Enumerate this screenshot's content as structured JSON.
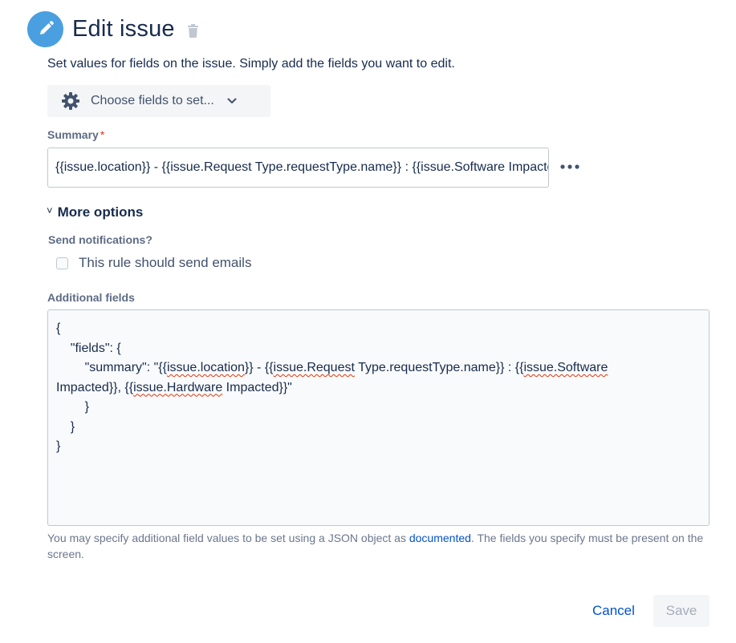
{
  "header": {
    "title": "Edit issue",
    "icon": "pencil-icon",
    "accent": "#4a9fe0"
  },
  "intro": "Set values for fields on the issue. Simply add the fields you want to edit.",
  "choose_fields": {
    "label": "Choose fields to set...",
    "icon": "gear-icon"
  },
  "summary": {
    "label": "Summary",
    "required_mark": "*",
    "value": "{{issue.location}} - {{issue.Request Type.requestType.name}} : {{issue.Software Impacted}}, {{issue.Hardware Impacted}}"
  },
  "more_options": {
    "caret": "˅",
    "label": "More options"
  },
  "notifications": {
    "label": "Send notifications?",
    "checkbox_label": "This rule should send emails",
    "checked": false
  },
  "additional_fields": {
    "label": "Additional fields",
    "lines": {
      "l1": "{",
      "l2": "    \"fields\": {",
      "l3_prefix": "        \"summary\": \"{{",
      "l3_w1": "issue.location",
      "l3_mid1": "}} - {{",
      "l3_w2": "issue.Request",
      "l3_mid2": " Type.requestType.name}} : {{",
      "l3_w3": "issue.Software",
      "l4_prefix": "Impacted}}, {{",
      "l4_w1": "issue.Hardware",
      "l4_suffix": " Impacted}}\"",
      "l5": "        }",
      "l6": "    }",
      "l7": "}"
    }
  },
  "help": {
    "before": "You may specify additional field values to be set using a JSON object as ",
    "link": "documented",
    "after": ". The fields you specify must be present on the screen."
  },
  "footer": {
    "cancel": "Cancel",
    "save": "Save"
  }
}
